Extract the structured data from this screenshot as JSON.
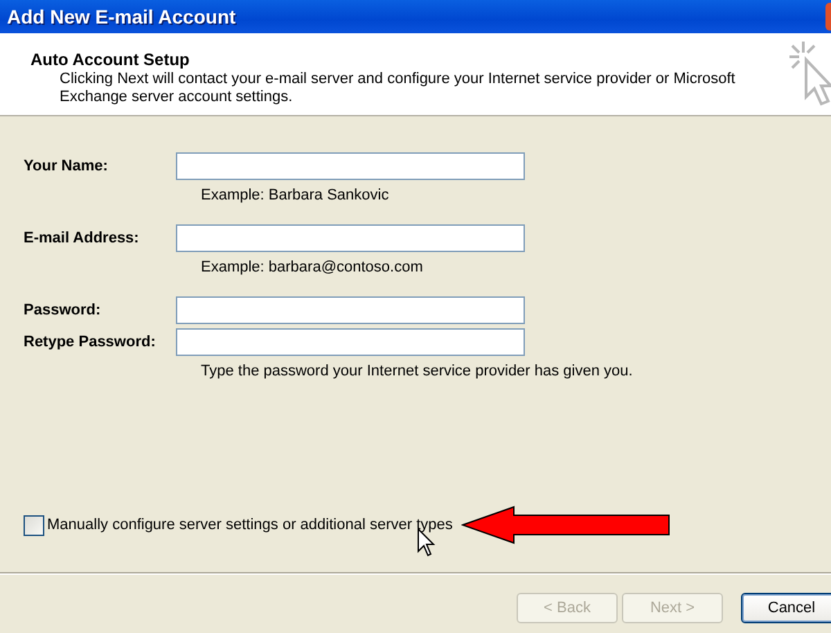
{
  "window": {
    "title": "Add New E-mail Account"
  },
  "header": {
    "title": "Auto Account Setup",
    "description": "Clicking Next will contact your e-mail server and configure your Internet service provider or Microsoft Exchange server account settings."
  },
  "fields": [
    {
      "label": "Your Name:",
      "hint": "Example: Barbara Sankovic"
    },
    {
      "label": "E-mail Address:",
      "hint": "Example: barbara@contoso.com"
    },
    {
      "label": "Password:"
    },
    {
      "label": "Retype Password:",
      "hint": "Type the password your Internet service provider has given you."
    }
  ],
  "manual_config": {
    "label": "Manually configure server settings or additional server types",
    "checked": false
  },
  "buttons": [
    {
      "label": "< Back",
      "disabled": true
    },
    {
      "label": "Next >",
      "disabled": true
    },
    {
      "label": "Cancel",
      "disabled": false
    }
  ]
}
